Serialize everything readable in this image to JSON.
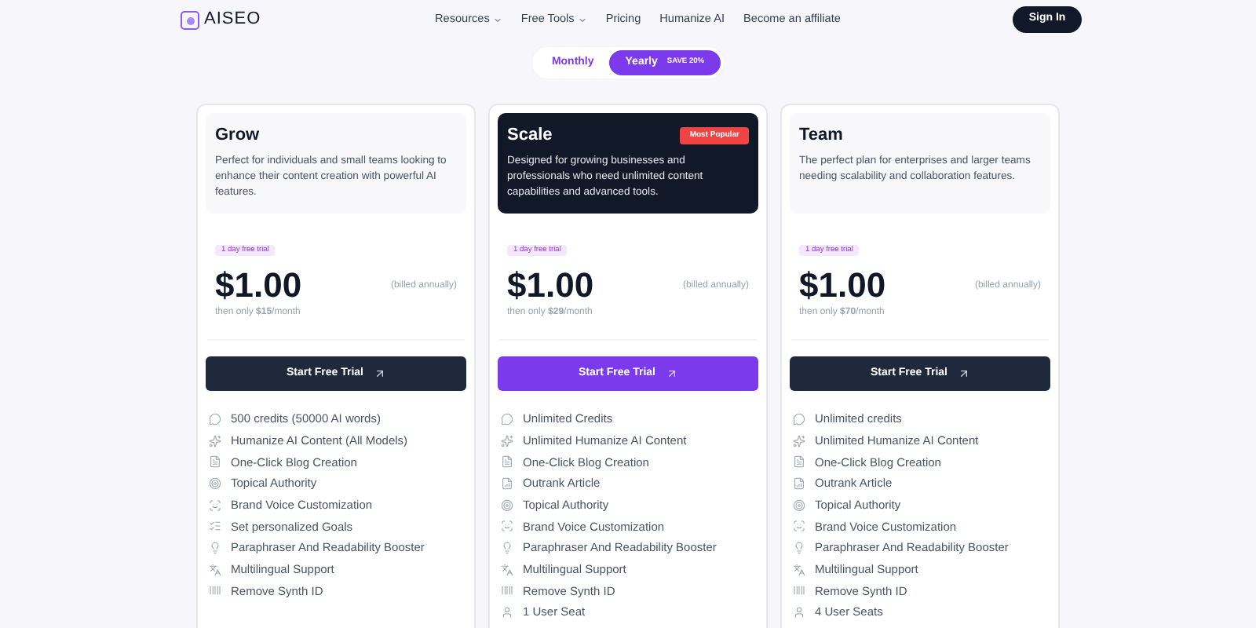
{
  "header": {
    "logo": "AISEO",
    "nav": [
      {
        "label": "Resources",
        "dropdown": true
      },
      {
        "label": "Free Tools",
        "dropdown": true
      },
      {
        "label": "Pricing",
        "dropdown": false
      },
      {
        "label": "Humanize AI",
        "dropdown": false
      },
      {
        "label": "Become an affiliate",
        "dropdown": false
      }
    ],
    "sign_in": "Sign In"
  },
  "billing_toggle": {
    "options": [
      {
        "label": "Monthly",
        "selected": false
      },
      {
        "label": "Yearly",
        "selected": true,
        "badge": "SAVE 20%"
      }
    ]
  },
  "plans": [
    {
      "name": "Grow",
      "featured": false,
      "description": "Perfect for individuals and small teams looking to enhance their content creation with powerful AI features.",
      "trial": "1 day free trial",
      "price": "$1.00",
      "billing": "(billed annually)",
      "then": "then only **$15**/month",
      "cta": "Start Free Trial",
      "features": [
        {
          "kind": "credits",
          "text": "500 credits (50000 AI words)"
        },
        {
          "kind": "humanize",
          "text": "Humanize AI Content (All Models)"
        },
        {
          "kind": "blog",
          "text": "One-Click Blog Creation"
        },
        {
          "kind": "authority",
          "text": "Topical Authority"
        },
        {
          "kind": "voice",
          "text": "Brand Voice Customization"
        },
        {
          "kind": "goals",
          "text": "Set personalized Goals"
        },
        {
          "kind": "paraphraser",
          "text": "Paraphraser And Readability Booster"
        },
        {
          "kind": "multilingual",
          "text": "Multilingual Support"
        },
        {
          "kind": "synth",
          "text": "Remove Synth ID"
        }
      ]
    },
    {
      "name": "Scale",
      "featured": true,
      "badge": "Most Popular",
      "description": "Designed for growing businesses and professionals who need unlimited content capabilities and advanced tools.",
      "trial": "1 day free trial",
      "price": "$1.00",
      "billing": "(billed annually)",
      "then": "then only **$29**/month",
      "cta": "Start Free Trial",
      "features": [
        {
          "kind": "credits",
          "text": "Unlimited Credits"
        },
        {
          "kind": "humanize",
          "text": "Unlimited Humanize AI Content"
        },
        {
          "kind": "blog",
          "text": "One-Click Blog Creation"
        },
        {
          "kind": "outrank",
          "text": "Outrank Article"
        },
        {
          "kind": "authority",
          "text": "Topical Authority"
        },
        {
          "kind": "voice",
          "text": "Brand Voice Customization"
        },
        {
          "kind": "paraphraser",
          "text": "Paraphraser And Readability Booster"
        },
        {
          "kind": "multilingual",
          "text": "Multilingual Support"
        },
        {
          "kind": "synth",
          "text": "Remove Synth ID"
        },
        {
          "kind": "seat",
          "text": "1 User Seat"
        }
      ]
    },
    {
      "name": "Team",
      "featured": false,
      "description": "The perfect plan for enterprises and larger teams needing scalability and collaboration features.",
      "trial": "1 day free trial",
      "price": "$1.00",
      "billing": "(billed annually)",
      "then": "then only **$70**/month",
      "cta": "Start Free Trial",
      "features": [
        {
          "kind": "credits",
          "text": "Unlimited credits"
        },
        {
          "kind": "humanize",
          "text": "Unlimited Humanize AI Content"
        },
        {
          "kind": "blog",
          "text": "One-Click Blog Creation"
        },
        {
          "kind": "outrank",
          "text": "Outrank Article"
        },
        {
          "kind": "authority",
          "text": "Topical Authority"
        },
        {
          "kind": "voice",
          "text": "Brand Voice Customization"
        },
        {
          "kind": "paraphraser",
          "text": "Paraphraser And Readability Booster"
        },
        {
          "kind": "multilingual",
          "text": "Multilingual Support"
        },
        {
          "kind": "synth",
          "text": "Remove Synth ID"
        },
        {
          "kind": "seat",
          "text": "4 User Seats"
        }
      ]
    }
  ]
}
